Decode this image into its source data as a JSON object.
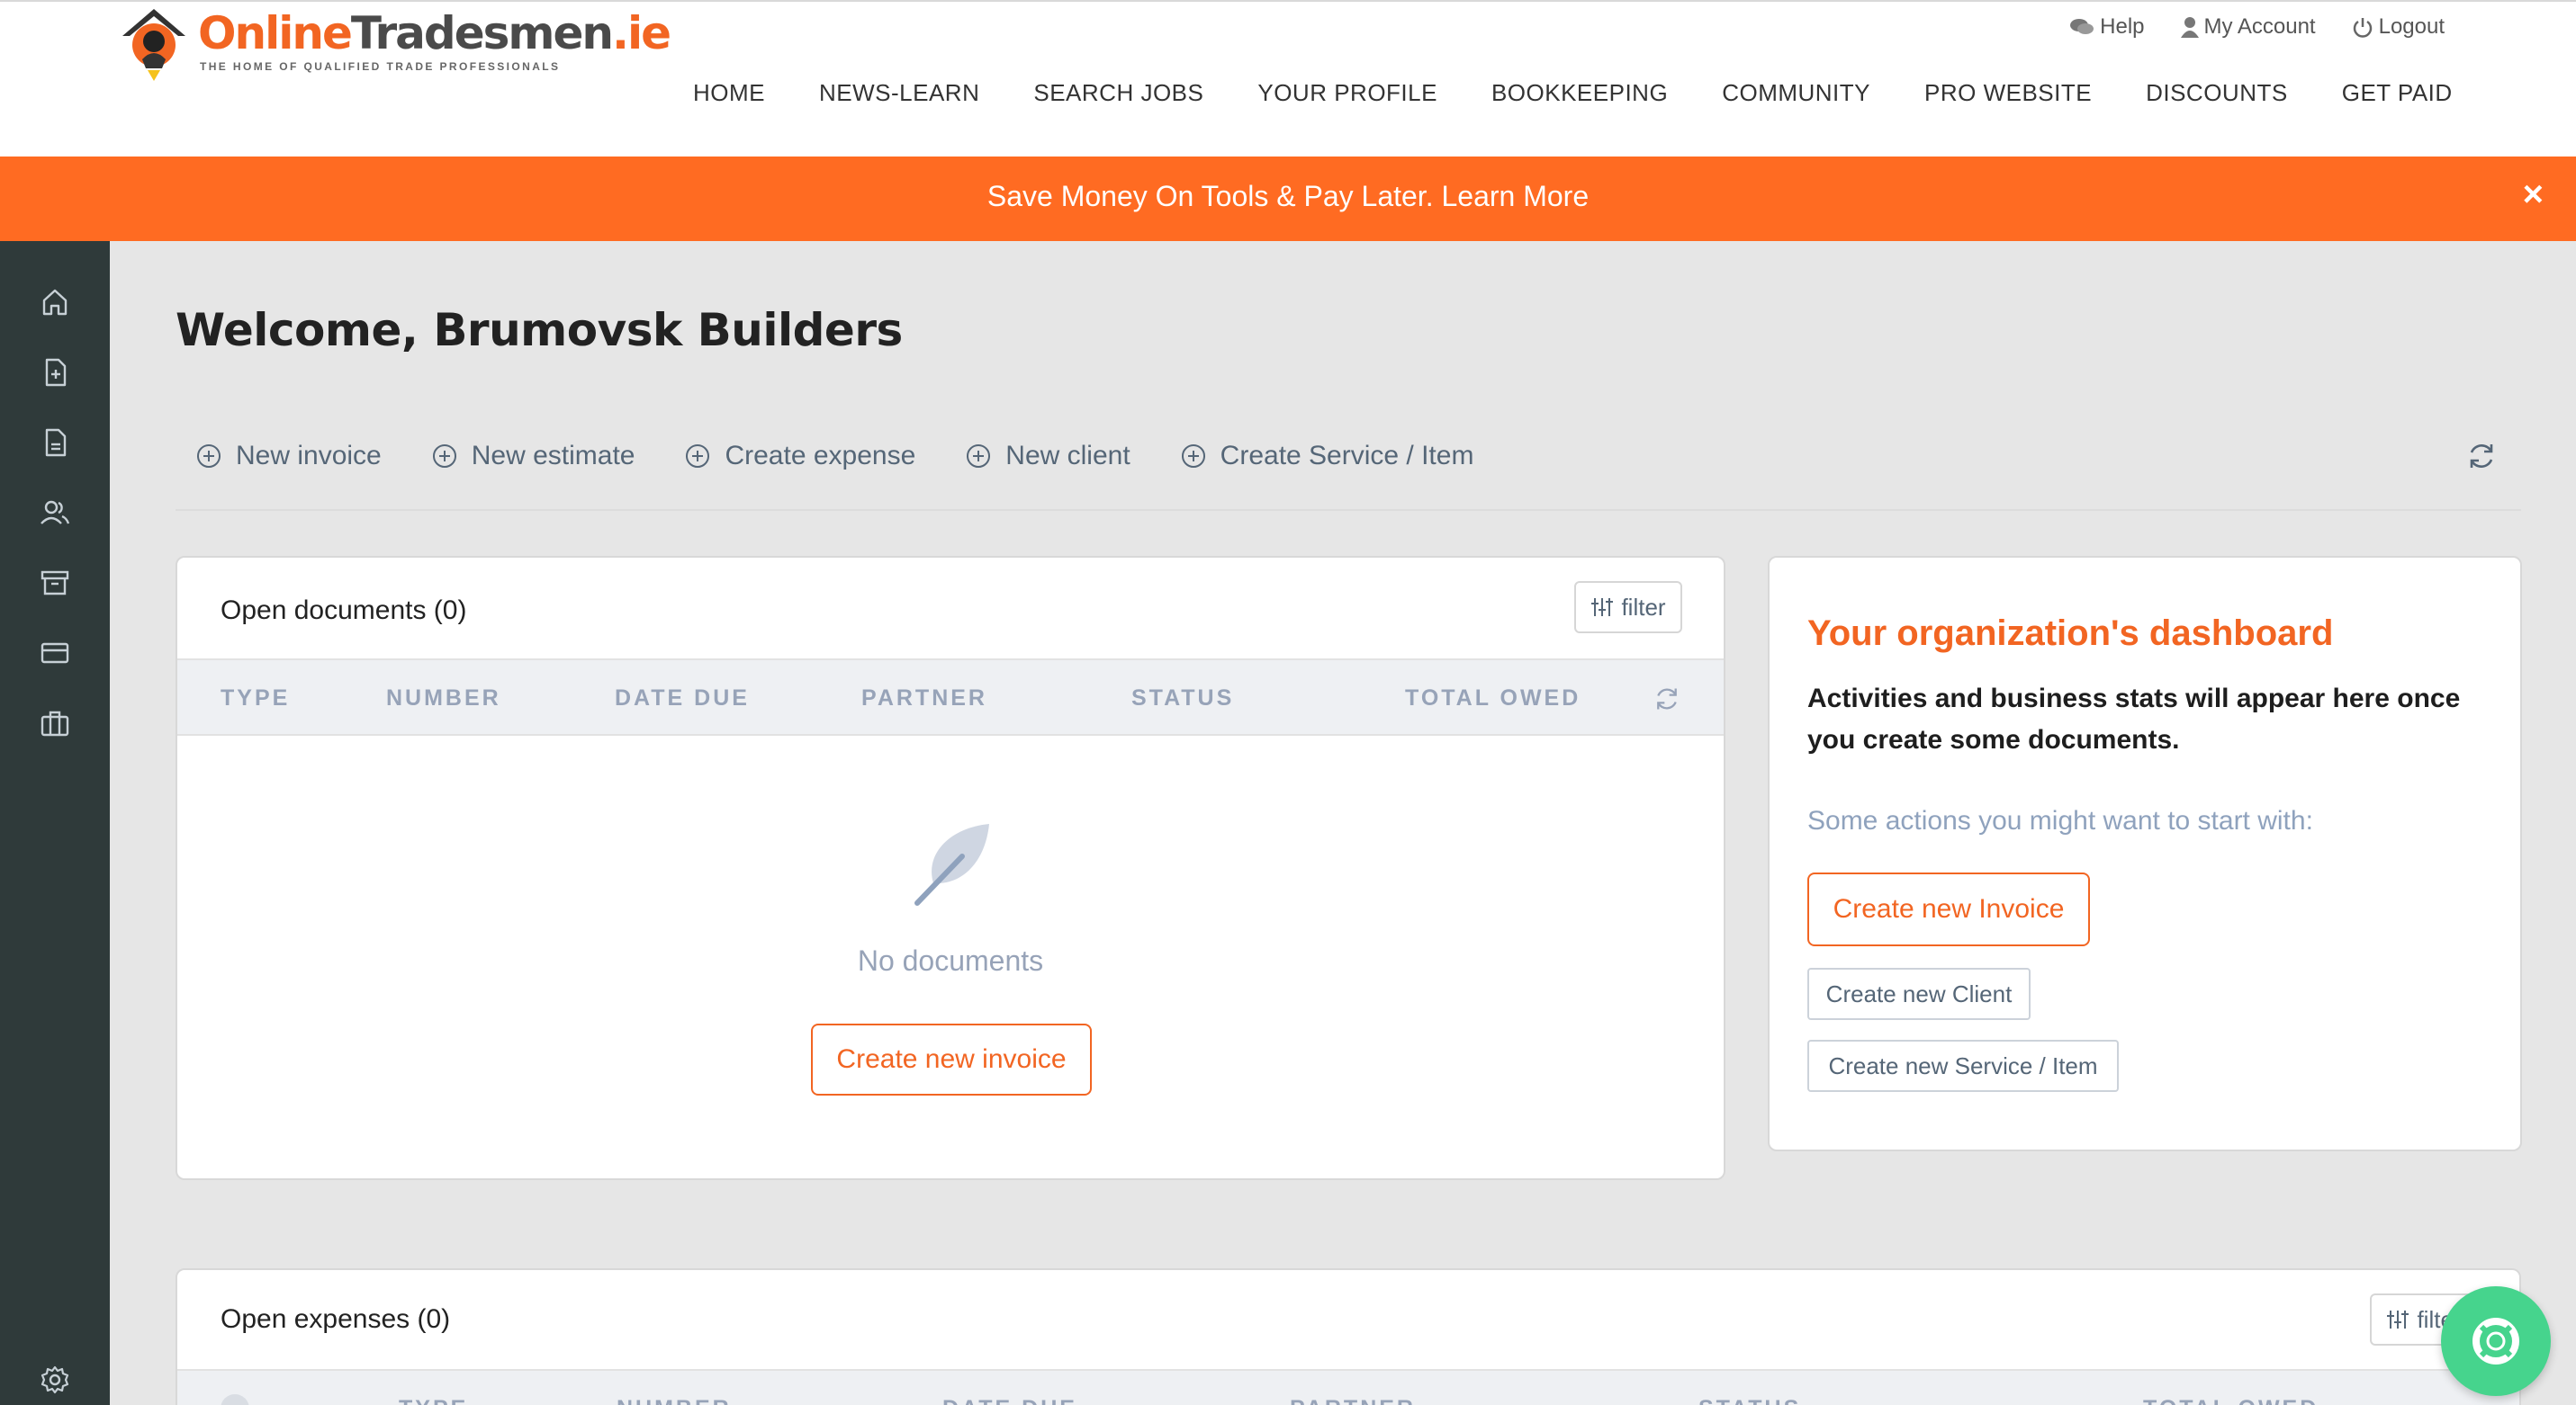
{
  "logo": {
    "text_part1": "Online",
    "text_part2": "Tradesmen",
    "text_part3": ".ie",
    "tagline": "THE HOME OF QUALIFIED TRADE PROFESSIONALS"
  },
  "utility_nav": {
    "help": "Help",
    "account": "My Account",
    "logout": "Logout"
  },
  "main_nav": [
    "HOME",
    "NEWS-LEARN",
    "SEARCH JOBS",
    "YOUR PROFILE",
    "BOOKKEEPING",
    "COMMUNITY",
    "PRO WEBSITE",
    "DISCOUNTS",
    "GET PAID"
  ],
  "promo": {
    "text": "Save Money On Tools & Pay Later. Learn More",
    "close": "×"
  },
  "sidebar": {
    "icons": [
      "home-icon",
      "new-document-icon",
      "document-icon",
      "users-icon",
      "archive-icon",
      "credit-card-icon",
      "briefcase-icon",
      "settings-icon"
    ]
  },
  "welcome": "Welcome, Brumovsk Builders",
  "quick_actions": [
    "New invoice",
    "New estimate",
    "Create expense",
    "New client",
    "Create Service / Item"
  ],
  "open_documents": {
    "title": "Open documents (0)",
    "filter": "filter",
    "columns": [
      "TYPE",
      "NUMBER",
      "DATE DUE",
      "PARTNER",
      "STATUS",
      "TOTAL OWED"
    ],
    "empty_text": "No documents",
    "create_button": "Create new invoice"
  },
  "dashboard": {
    "title": "Your organization's dashboard",
    "description": "Activities and business stats will appear here once you create some documents.",
    "suggestion": "Some actions you might want to start with:",
    "primary_action": "Create new Invoice",
    "secondary_actions": [
      "Create new Client",
      "Create new Service / Item"
    ]
  },
  "open_expenses": {
    "title": "Open expenses (0)",
    "filter": "filter",
    "columns": [
      "TYPE",
      "NUMBER",
      "DATE DUE",
      "PARTNER",
      "STATUS",
      "TOTAL OWED"
    ]
  },
  "colors": {
    "accent": "#f26522",
    "promo": "#ff6b22",
    "sidebar": "#2f3a3a",
    "chat": "#46d48d",
    "muted": "#97a3b8"
  }
}
